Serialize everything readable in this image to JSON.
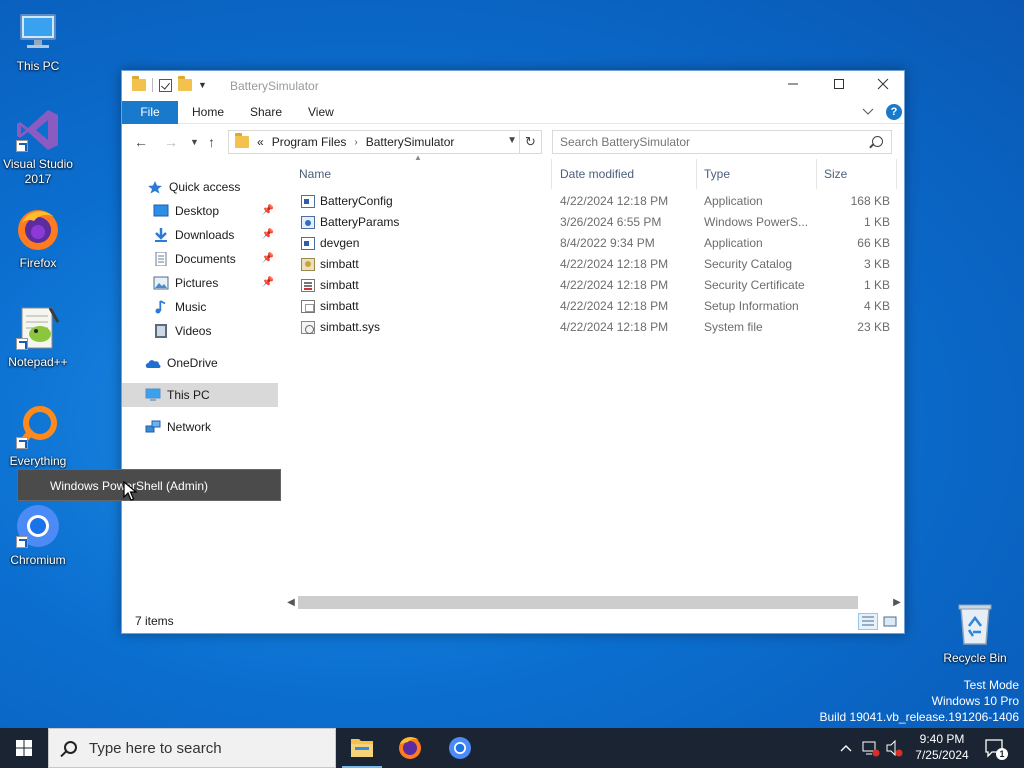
{
  "desktop": {
    "icons": [
      {
        "label": "This PC"
      },
      {
        "label": "Visual Studio 2017"
      },
      {
        "label": "Firefox"
      },
      {
        "label": "Notepad++"
      },
      {
        "label": "Everything"
      },
      {
        "label": "Chromium"
      },
      {
        "label": "Recycle Bin"
      }
    ],
    "tooltip": "Windows PowerShell (Admin)",
    "watermark": {
      "line1": "Test Mode",
      "line2": "Windows 10 Pro",
      "line3": "Build 19041.vb_release.191206-1406"
    }
  },
  "window": {
    "title": "BatterySimulator",
    "ribbon_tabs": [
      "File",
      "Home",
      "Share",
      "View"
    ],
    "breadcrumb": {
      "prefix": "«",
      "items": [
        "Program Files",
        "BatterySimulator"
      ]
    },
    "search_placeholder": "Search BatterySimulator",
    "nav": {
      "quick_access": "Quick access",
      "items": [
        "Desktop",
        "Downloads",
        "Documents",
        "Pictures",
        "Music",
        "Videos"
      ],
      "onedrive": "OneDrive",
      "this_pc": "This PC",
      "network": "Network"
    },
    "columns": {
      "name": "Name",
      "date": "Date modified",
      "type": "Type",
      "size": "Size"
    },
    "files": [
      {
        "name": "BatteryConfig",
        "date": "4/22/2024 12:18 PM",
        "type": "Application",
        "size": "168 KB",
        "icon": "app-icon"
      },
      {
        "name": "BatteryParams",
        "date": "3/26/2024 6:55 PM",
        "type": "Windows PowerS...",
        "size": "1 KB",
        "icon": "powershell-script-icon"
      },
      {
        "name": "devgen",
        "date": "8/4/2022 9:34 PM",
        "type": "Application",
        "size": "66 KB",
        "icon": "app-icon"
      },
      {
        "name": "simbatt",
        "date": "4/22/2024 12:18 PM",
        "type": "Security Catalog",
        "size": "3 KB",
        "icon": "security-catalog-icon"
      },
      {
        "name": "simbatt",
        "date": "4/22/2024 12:18 PM",
        "type": "Security Certificate",
        "size": "1 KB",
        "icon": "certificate-icon"
      },
      {
        "name": "simbatt",
        "date": "4/22/2024 12:18 PM",
        "type": "Setup Information",
        "size": "4 KB",
        "icon": "setup-info-icon"
      },
      {
        "name": "simbatt.sys",
        "date": "4/22/2024 12:18 PM",
        "type": "System file",
        "size": "23 KB",
        "icon": "system-file-icon"
      }
    ],
    "status": "7 items"
  },
  "taskbar": {
    "search_placeholder": "Type here to search",
    "time": "9:40 PM",
    "date": "7/25/2024",
    "notification_count": "1"
  },
  "colors": {
    "accent": "#1979ca",
    "desktop": "#0b6fd0",
    "taskbar": "#1a2433"
  }
}
